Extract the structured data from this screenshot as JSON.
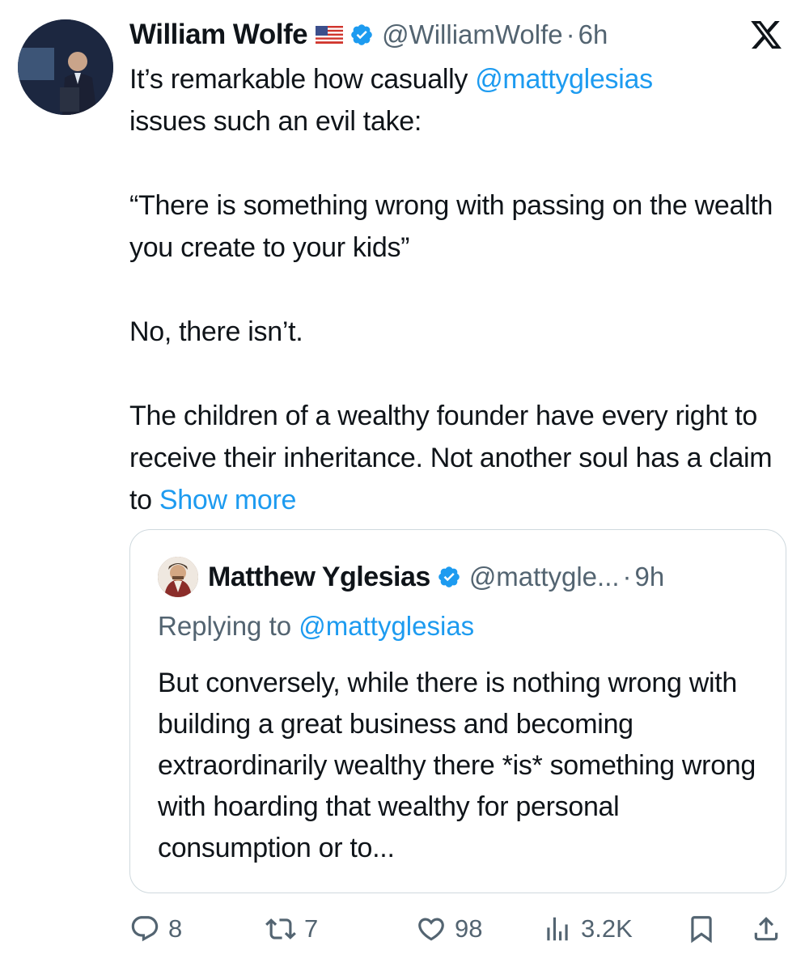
{
  "tweet": {
    "author_name": "William Wolfe",
    "flag_icon": "us-flag-icon",
    "verified_icon": "verified-badge-icon",
    "handle": "@WilliamWolfe",
    "separator": "·",
    "time": "6h",
    "paragraphs": {
      "p1_prefix": "It’s remarkable how casually ",
      "p1_mention": "@mattyglesias",
      "p1_suffix": "issues such an evil take:",
      "p2": "“There is something wrong with passing on the wealth you create to your kids”",
      "p3": "No, there isn’t.",
      "p4": "The children of a wealthy founder have every right to receive their inheritance. Not another soul has a claim to ",
      "show_more": "Show more"
    }
  },
  "quote": {
    "author_name": "Matthew Yglesias",
    "handle": "@mattygle...",
    "separator": "·",
    "time": "9h",
    "replying_prefix": "Replying to ",
    "replying_mention": "@mattyglesias",
    "text": "But conversely, while there is nothing wrong with building a great business and becoming extraordinarily wealthy there *is* something wrong with hoarding that wealthy for personal consumption or to..."
  },
  "actions": {
    "replies": "8",
    "reposts": "7",
    "likes": "98",
    "views": "3.2K"
  },
  "colors": {
    "link": "#1d9bf0",
    "secondary": "#536471",
    "border": "#cfd9de",
    "text": "#0f1419"
  }
}
